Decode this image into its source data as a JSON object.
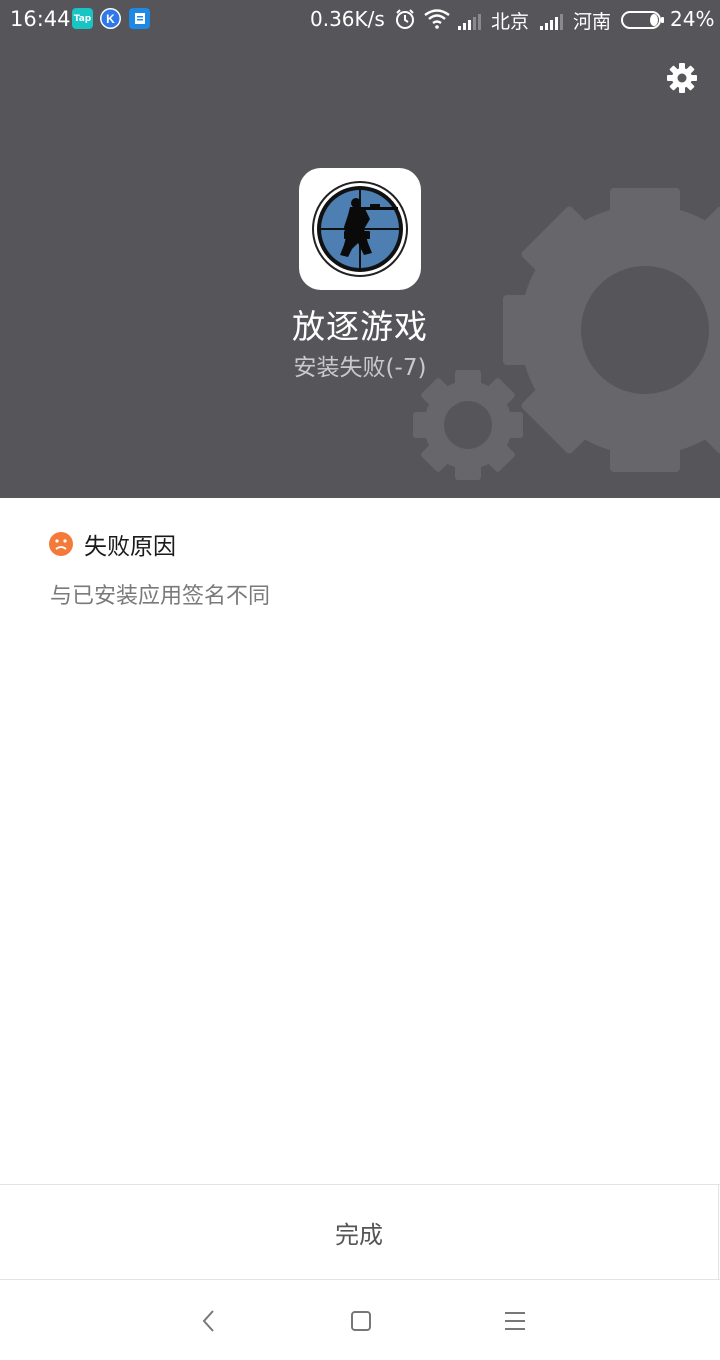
{
  "status_bar": {
    "time": "16:44",
    "app_icons": [
      {
        "name": "taptap-icon",
        "label": "Tap",
        "color": "#19c4c4"
      },
      {
        "name": "k-app-icon",
        "label": "K",
        "color": "#2f78e8"
      },
      {
        "name": "notes-app-icon",
        "label": "",
        "color": "#1e88e5"
      }
    ],
    "net_speed": "0.36K/s",
    "carrier1": "北京",
    "carrier2": "河南",
    "battery_percent": "24%",
    "battery_level": 0.24
  },
  "header": {
    "background_color": "#56555a",
    "app_name": "放逐游戏",
    "install_status": "安装失败(-7)",
    "settings_icon": "gear-icon"
  },
  "failure": {
    "title": "失败原因",
    "reason": "与已安装应用签名不同",
    "icon": "sad-face-icon",
    "icon_color": "#f47a3a"
  },
  "footer": {
    "done_label": "完成"
  },
  "navbar": {
    "buttons": [
      "back-icon",
      "home-icon",
      "menu-icon"
    ]
  }
}
